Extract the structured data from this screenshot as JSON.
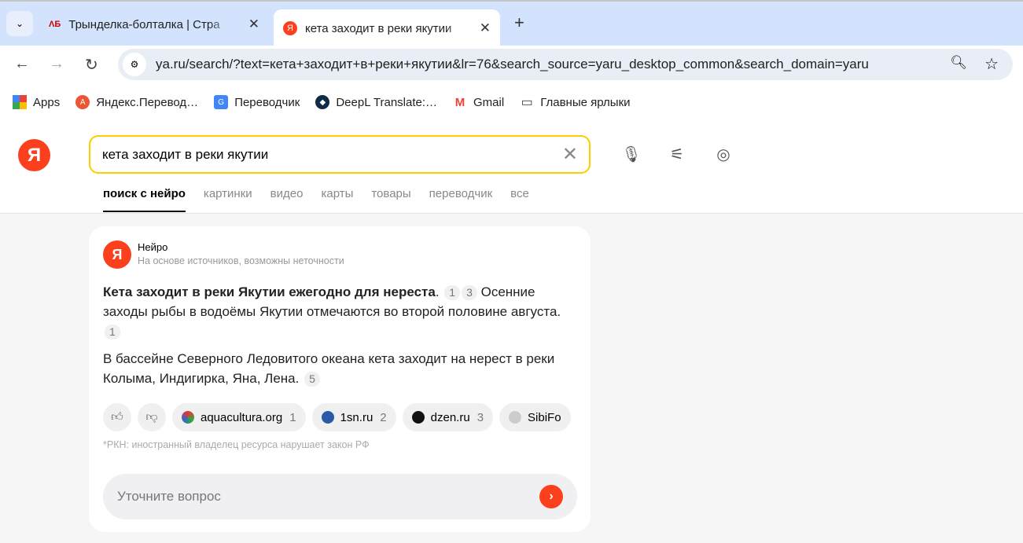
{
  "browser": {
    "tabs": [
      {
        "title": "Трынделка-болталка | Стра",
        "active": false
      },
      {
        "title": "кета заходит в реки якутии",
        "active": true
      }
    ],
    "url": "ya.ru/search/?text=кета+заходит+в+реки+якутии&lr=76&search_source=yaru_desktop_common&search_domain=yaru",
    "bookmarks": [
      "Apps",
      "Яндекс.Перевод…",
      "Переводчик",
      "DeepL Translate:…",
      "Gmail",
      "Главные ярлыки"
    ]
  },
  "search": {
    "logo": "Я",
    "query": "кета заходит в реки якутии",
    "tabs": [
      "поиск с нейро",
      "картинки",
      "видео",
      "карты",
      "товары",
      "переводчик",
      "все"
    ]
  },
  "answer": {
    "name": "Нейро",
    "subtitle": "На основе источников, возможны неточности",
    "bold": "Кета заходит в реки Якутии ежегодно для нереста",
    "p1_refs": [
      "1",
      "3"
    ],
    "p1_rest": "Осенние заходы рыбы в водоёмы Якутии отмечаются во второй половине августа.",
    "p1_ref_end": "1",
    "p2": "В бассейне Северного Ледовитого океана кета заходит на нерест в реки Колыма, Индигирка, Яна, Лена.",
    "p2_ref": "5",
    "sources": [
      {
        "name": "aquacultura.org",
        "n": "1"
      },
      {
        "name": "1sn.ru",
        "n": "2"
      },
      {
        "name": "dzen.ru",
        "n": "3"
      },
      {
        "name": "SibiFo",
        "n": ""
      }
    ],
    "rkn": "*РКН: иностранный владелец ресурса нарушает закон РФ",
    "ask_placeholder": "Уточните вопрос"
  },
  "colors": {
    "brand": "#fc3f1d",
    "search_border": "#ffcc00"
  }
}
